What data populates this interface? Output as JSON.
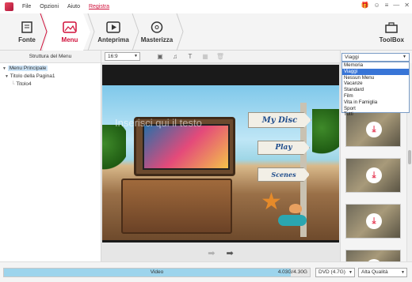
{
  "menubar": {
    "items": [
      "File",
      "Opzioni",
      "Aiuto",
      "Registra"
    ]
  },
  "tabs": [
    {
      "label": "Fonte"
    },
    {
      "label": "Menu"
    },
    {
      "label": "Anteprima"
    },
    {
      "label": "Masterizza"
    }
  ],
  "toolbox": {
    "label": "ToolBox"
  },
  "left_panel": {
    "title": "Struttura del Menu",
    "tree": [
      {
        "label": "Menu Principale",
        "level": 0,
        "selected": true
      },
      {
        "label": "Titolo della Pagina1",
        "level": 1,
        "selected": false
      },
      {
        "label": "Titolo4",
        "level": 2,
        "selected": false
      }
    ]
  },
  "preview_toolbar": {
    "aspect_ratio": "16:9"
  },
  "preview": {
    "placeholder_text": "Inserisci qui il testo",
    "signs": [
      "My Disc",
      "Play",
      "Scenes"
    ]
  },
  "category": {
    "selected": "Viaggi",
    "options": [
      "Memoria",
      "Viaggi",
      "Nessun Menu",
      "Vacanze",
      "Standard",
      "Film",
      "Vita in Famiglia",
      "Sport",
      "Tutti"
    ],
    "highlighted": "Viaggi"
  },
  "bottom": {
    "capacity_label": "Video",
    "capacity_text": "4.03G/4.30G",
    "capacity_fraction": 0.937,
    "disc_type": "DVD (4.7G)",
    "quality": "Alta Qualità"
  },
  "colors": {
    "accent": "#d0103a",
    "capacity_fill": "#9dd4ec",
    "highlight": "#3875d7"
  }
}
